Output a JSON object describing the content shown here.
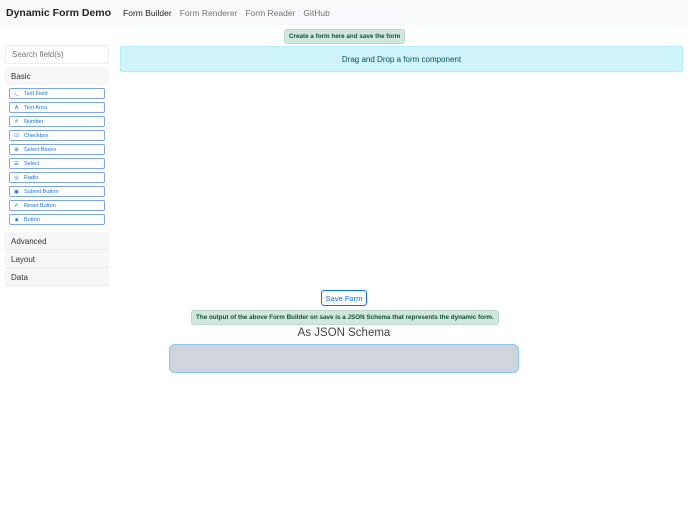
{
  "nav": {
    "brand": "Dynamic Form Demo",
    "links": [
      "Form Builder",
      "Form Renderer",
      "Form Reader",
      "GitHub"
    ]
  },
  "builder": {
    "hint": "Create a form here and save the form",
    "search_placeholder": "Search field(s)",
    "drop_text": "Drag and Drop a form component",
    "groups": [
      "Basic",
      "Advanced",
      "Layout",
      "Data"
    ],
    "basic_items": [
      {
        "label": "Text Field",
        "icon": "terminal-icon"
      },
      {
        "label": "Text Area",
        "icon": "font-icon"
      },
      {
        "label": "Number",
        "icon": "hash-icon"
      },
      {
        "label": "Checkbox",
        "icon": "checkbox-icon"
      },
      {
        "label": "Select Boxes",
        "icon": "plus-square-icon"
      },
      {
        "label": "Select",
        "icon": "list-icon"
      },
      {
        "label": "Radio",
        "icon": "radio-icon"
      },
      {
        "label": "Submit Button",
        "icon": "save-icon"
      },
      {
        "label": "Reset Button",
        "icon": "eraser-icon"
      },
      {
        "label": "Button",
        "icon": "stop-icon"
      }
    ]
  },
  "save_label": "Save Form",
  "output_note": "The output of the above Form Builder on save is a JSON Schema that represents the dynamic form.",
  "schema_heading": "As JSON Schema"
}
